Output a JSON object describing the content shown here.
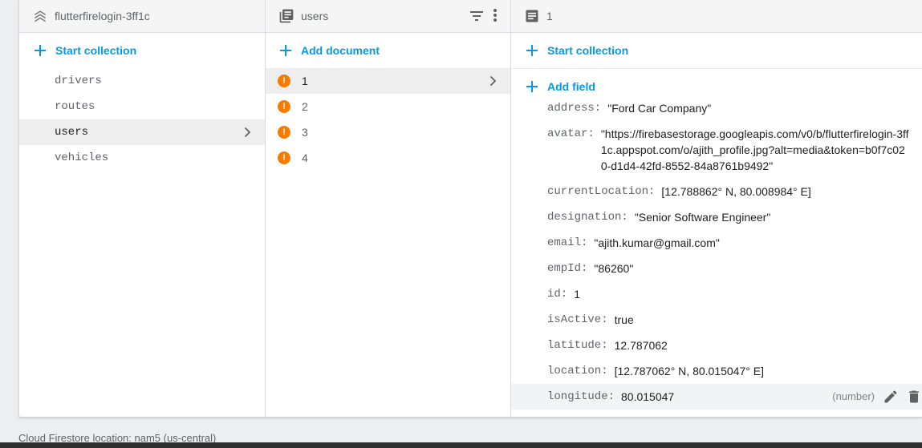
{
  "col1": {
    "title": "flutterfirelogin-3ff1c",
    "title_icon": "project-home-icon",
    "action_label": "Start collection",
    "items": [
      "drivers",
      "routes",
      "users",
      "vehicles"
    ],
    "selected": "users"
  },
  "col2": {
    "title": "users",
    "title_icon": "collection-icon",
    "action_label": "Add document",
    "items": [
      "1",
      "2",
      "3",
      "4"
    ],
    "selected": "1",
    "warn_symbol": "!"
  },
  "col3": {
    "title": "1",
    "title_icon": "document-icon",
    "start_label": "Start collection",
    "add_field_label": "Add field",
    "fields": [
      {
        "key": "address:",
        "value": "\"Ford Car Company\""
      },
      {
        "key": "avatar:",
        "value": "\"https://firebasestorage.googleapis.com/v0/b/flutterfirelogin-3ff1c.appspot.com/o/ajith_profile.jpg?alt=media&token=b0f7c020-d1d4-42fd-8552-84a8761b9492\""
      },
      {
        "key": "currentLocation:",
        "value": "[12.788862° N, 80.008984° E]"
      },
      {
        "key": "designation:",
        "value": "\"Senior Software Engineer\""
      },
      {
        "key": "email:",
        "value": "\"ajith.kumar@gmail.com\""
      },
      {
        "key": "empId:",
        "value": "\"86260\""
      },
      {
        "key": "id:",
        "value": "1"
      },
      {
        "key": "isActive:",
        "value": "true"
      },
      {
        "key": "latitude:",
        "value": "12.787062"
      },
      {
        "key": "location:",
        "value": "[12.787062° N, 80.015047° E]"
      },
      {
        "key": "longitude:",
        "value": "80.015047"
      }
    ],
    "hover_type": "(number)"
  },
  "footer": "Cloud Firestore location: nam5 (us-central)",
  "colors": {
    "accent": "#039be5",
    "warning": "#f57c00",
    "header_bg": "#f5f5f5",
    "selected_bg": "#eeeeee"
  }
}
